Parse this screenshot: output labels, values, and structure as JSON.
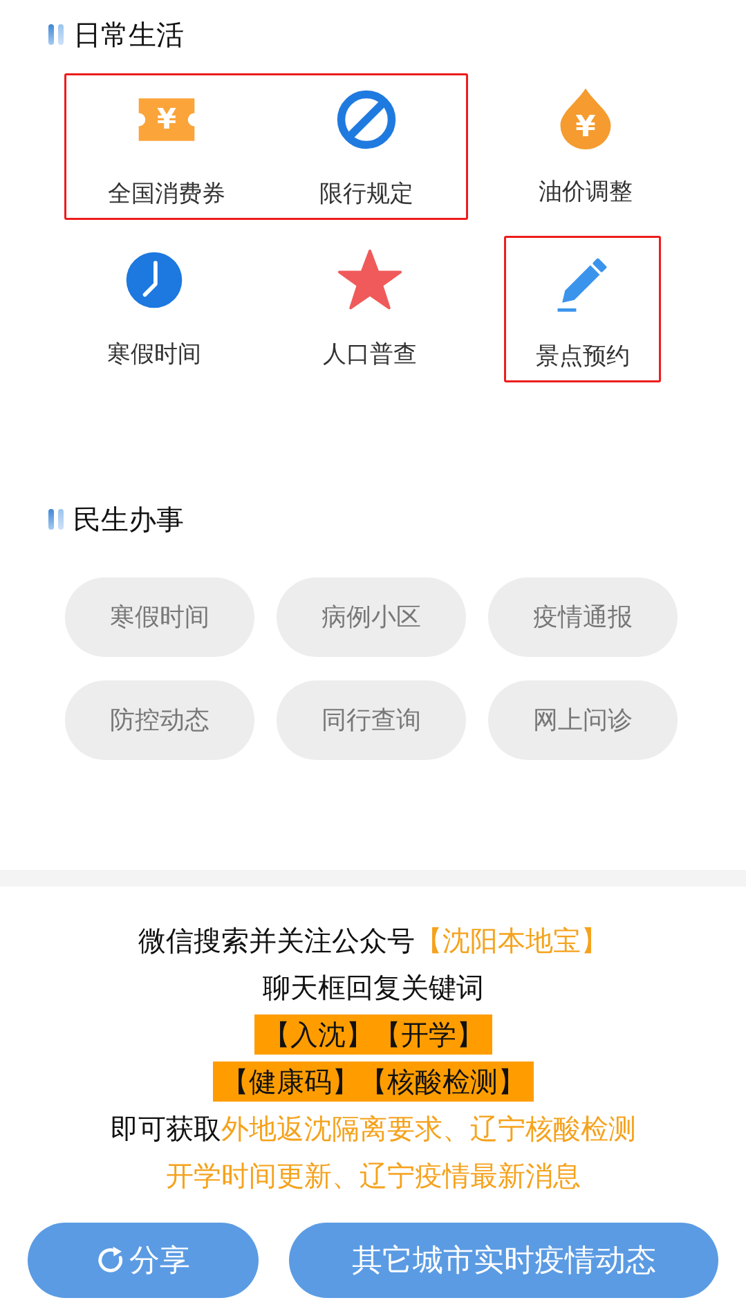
{
  "daily_life": {
    "title": "日常生活",
    "rows": [
      {
        "groups": [
          {
            "highlighted": true,
            "items": [
              {
                "label": "全国消费券",
                "kind": "ticket",
                "symbol": "¥"
              },
              {
                "label": "限行规定",
                "kind": "no-entry"
              }
            ]
          },
          {
            "highlighted": false,
            "items": [
              {
                "label": "油价调整",
                "kind": "drop",
                "symbol": "¥"
              }
            ]
          }
        ]
      },
      {
        "groups": [
          {
            "highlighted": false,
            "items": [
              {
                "label": "寒假时间",
                "kind": "clock"
              },
              {
                "label": "人口普查",
                "kind": "star"
              }
            ]
          },
          {
            "highlighted": true,
            "items": [
              {
                "label": "景点预约",
                "kind": "pencil"
              }
            ]
          }
        ]
      }
    ]
  },
  "services": {
    "title": "民生办事",
    "pills": [
      "寒假时间",
      "病例小区",
      "疫情通报",
      "防控动态",
      "同行查询",
      "网上问诊"
    ]
  },
  "notice": [
    {
      "kind": "plain",
      "segments": [
        {
          "text": "微信搜索并关注公众号",
          "accent": false
        },
        {
          "text": "【沈阳本地宝】",
          "accent": true
        }
      ]
    },
    {
      "kind": "plain",
      "segments": [
        {
          "text": "聊天框回复关键词",
          "accent": false
        }
      ]
    },
    {
      "kind": "highlight",
      "segments": [
        {
          "text": "【入沈】【开学】",
          "accent": false
        }
      ]
    },
    {
      "kind": "highlight",
      "segments": [
        {
          "text": "【健康码】【核酸检测】",
          "accent": false
        }
      ]
    },
    {
      "kind": "plain",
      "segments": [
        {
          "text": "即可获取",
          "accent": false
        },
        {
          "text": "外地返沈隔离要求、辽宁核酸检测",
          "accent": true
        }
      ]
    },
    {
      "kind": "plain",
      "segments": [
        {
          "text": "开学时间更新、辽宁疫情最新消息",
          "accent": true
        }
      ]
    }
  ],
  "buttons": [
    {
      "label": "分享",
      "kind": "share"
    },
    {
      "label": "其它城市实时疫情动态",
      "kind": "plain"
    }
  ]
}
